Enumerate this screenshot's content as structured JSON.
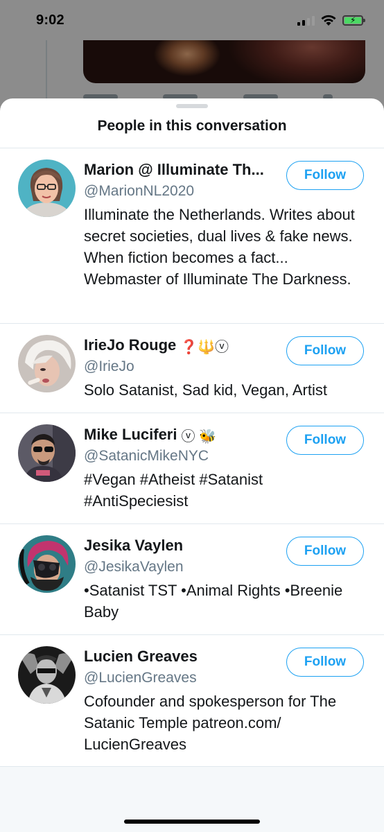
{
  "status_bar": {
    "time": "9:02"
  },
  "sheet": {
    "title": "People in this conversation"
  },
  "people": [
    {
      "display_name": "Marion @ Illuminate Th...",
      "badges": "",
      "handle": "@MarionNL2020",
      "bio": "Illuminate the Netherlands. Writes about secret societies, dual lives & fake news. When fiction becomes a fact... Webmaster of Illuminate The Darkness.",
      "follow_label": "Follow"
    },
    {
      "display_name": "IrieJo Rouge",
      "badges": "❓🔱ⓥ",
      "handle": "@IrieJo",
      "bio": "Solo Satanist, Sad kid, Vegan, Artist",
      "follow_label": "Follow"
    },
    {
      "display_name": "Mike Luciferi",
      "badges": "ⓥ 🐝",
      "handle": "@SatanicMikeNYC",
      "bio": "#Vegan #Atheist #Satanist #AntiSpeciesist",
      "follow_label": "Follow"
    },
    {
      "display_name": "Jesika Vaylen",
      "badges": "",
      "handle": "@JesikaVaylen",
      "bio": "•Satanist TST •Animal Rights •Breenie Baby",
      "follow_label": "Follow"
    },
    {
      "display_name": "Lucien Greaves",
      "badges": "",
      "handle": "@LucienGreaves",
      "bio": "Cofounder and spokesperson for The Satanic Temple patreon.com/ LucienGreaves",
      "follow_label": "Follow"
    }
  ],
  "colors": {
    "accent": "#1da1f2",
    "secondary_text": "#657786",
    "divider": "#e1e8ed"
  }
}
